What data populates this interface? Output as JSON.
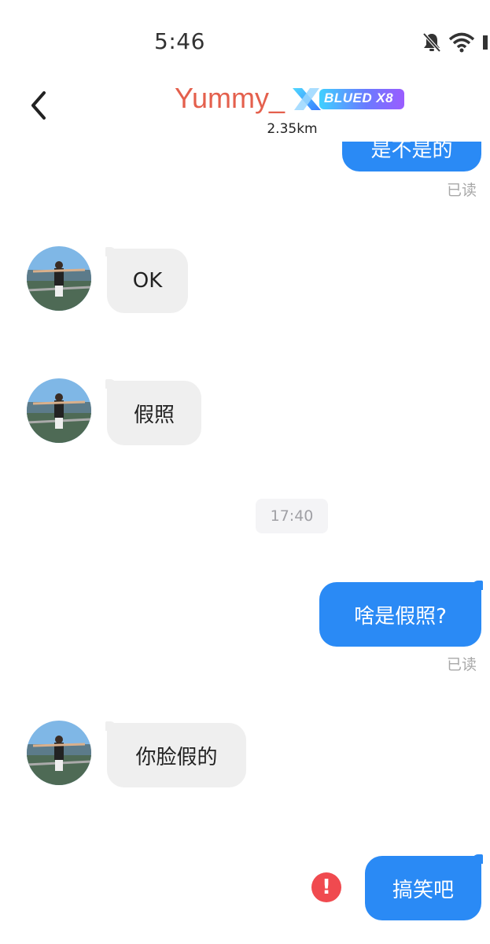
{
  "status_bar": {
    "time": "5:46"
  },
  "header": {
    "title": "Yummy_",
    "vip_badge": "BLUED X8",
    "distance": "2.35km"
  },
  "messages": {
    "m0_partial": "是不是的",
    "m0_read": "已读",
    "m1": "OK",
    "m2": "假照",
    "timestamp": "17:40",
    "m3": "啥是假照?",
    "m3_read": "已读",
    "m4": "你脸假的",
    "m5": "搞笑吧",
    "m5_error_icon": "!"
  },
  "colors": {
    "outgoing_bubble": "#2a8af5",
    "incoming_bubble": "#efefef",
    "title": "#e4604d",
    "error": "#f04a4f"
  },
  "icons": [
    "bell-off-icon",
    "wifi-icon",
    "back-arrow-icon",
    "error-icon"
  ]
}
